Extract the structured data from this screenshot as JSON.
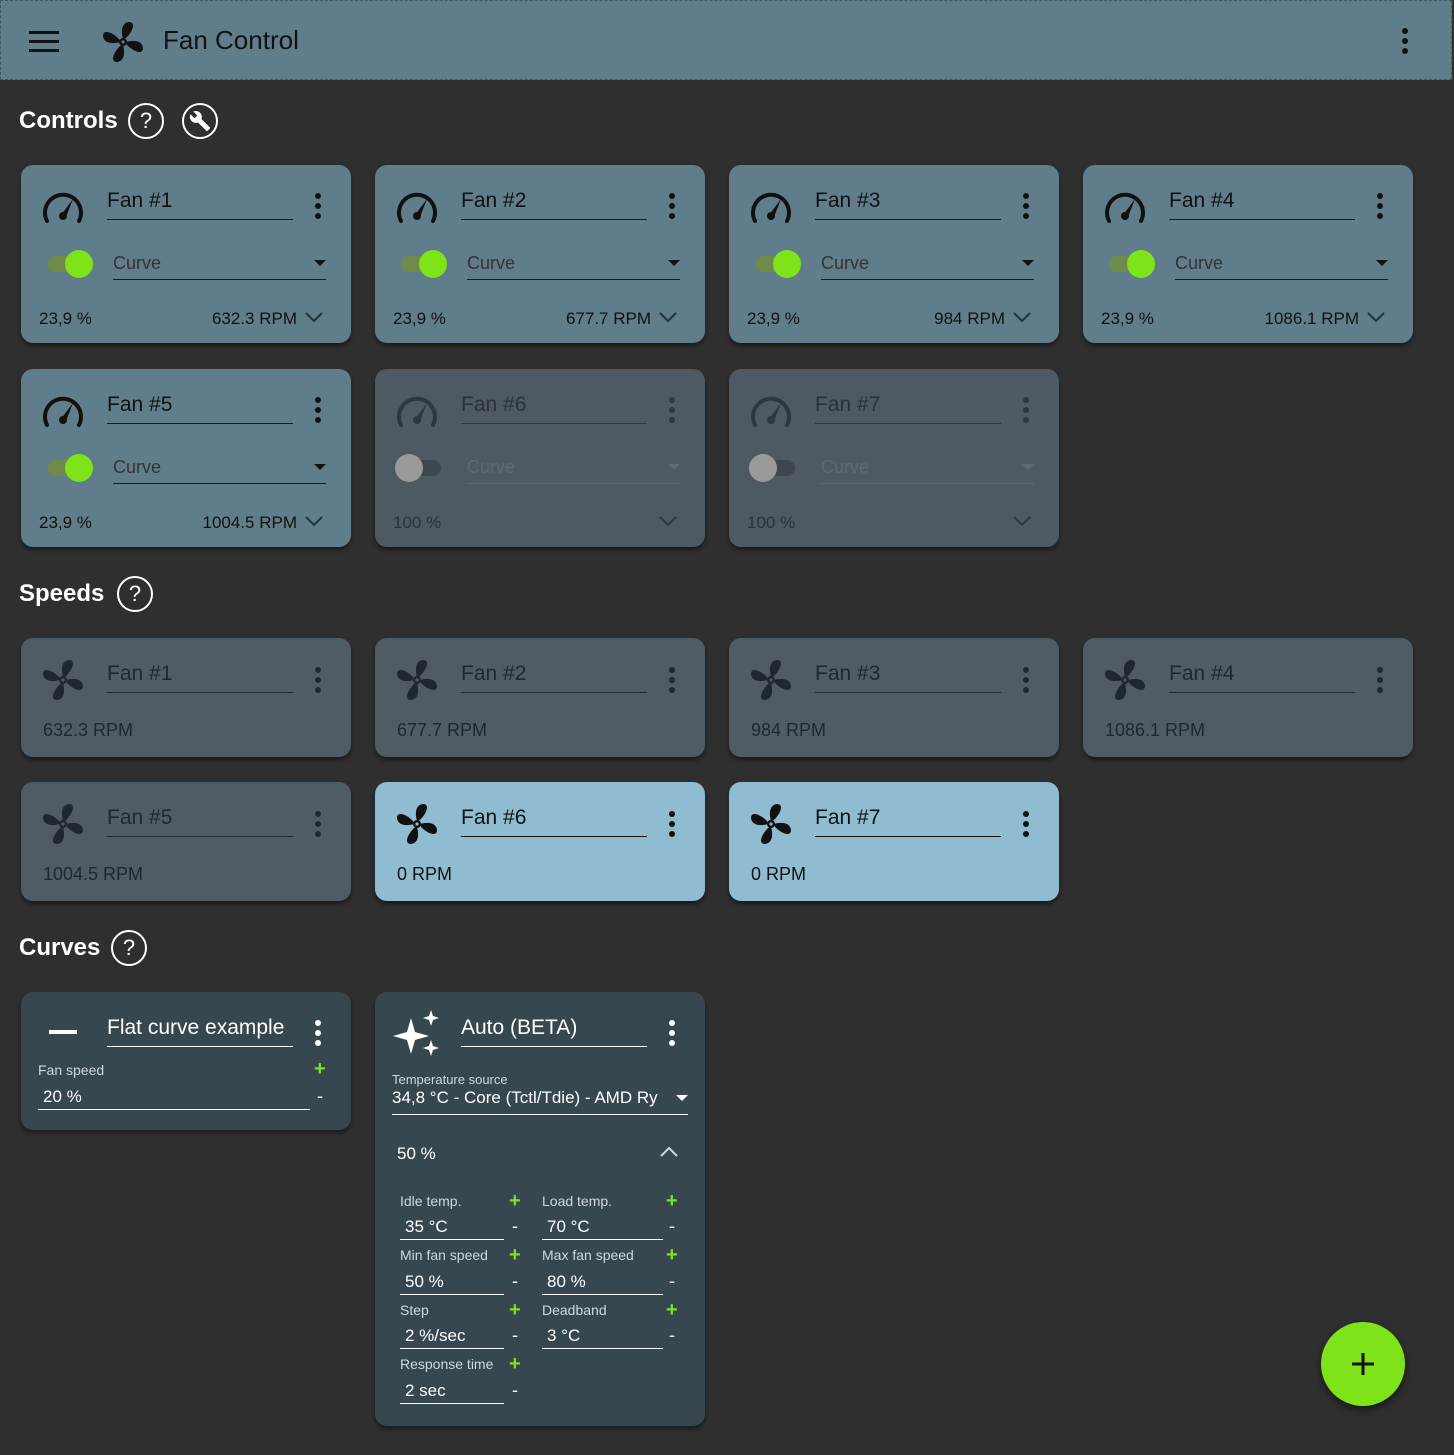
{
  "app": {
    "title": "Fan Control"
  },
  "sections": {
    "controls": "Controls",
    "speeds": "Speeds",
    "curves": "Curves",
    "help_glyph": "?"
  },
  "controls": [
    {
      "name": "Fan #1",
      "mode": "Curve",
      "percent": "23,9 %",
      "rpm": "632.3 RPM",
      "enabled": true
    },
    {
      "name": "Fan #2",
      "mode": "Curve",
      "percent": "23,9 %",
      "rpm": "677.7 RPM",
      "enabled": true
    },
    {
      "name": "Fan #3",
      "mode": "Curve",
      "percent": "23,9 %",
      "rpm": "984 RPM",
      "enabled": true
    },
    {
      "name": "Fan #4",
      "mode": "Curve",
      "percent": "23,9 %",
      "rpm": "1086.1 RPM",
      "enabled": true
    },
    {
      "name": "Fan #5",
      "mode": "Curve",
      "percent": "23,9 %",
      "rpm": "1004.5 RPM",
      "enabled": true
    },
    {
      "name": "Fan #6",
      "mode": "Curve",
      "percent": "100 %",
      "rpm": "",
      "enabled": false
    },
    {
      "name": "Fan #7",
      "mode": "Curve",
      "percent": "100 %",
      "rpm": "",
      "enabled": false
    }
  ],
  "speeds": [
    {
      "name": "Fan #1",
      "rpm": "632.3 RPM"
    },
    {
      "name": "Fan #2",
      "rpm": "677.7 RPM"
    },
    {
      "name": "Fan #3",
      "rpm": "984 RPM"
    },
    {
      "name": "Fan #4",
      "rpm": "1086.1 RPM"
    },
    {
      "name": "Fan #5",
      "rpm": "1004.5 RPM"
    },
    {
      "name": "Fan #6",
      "rpm": "0 RPM"
    },
    {
      "name": "Fan #7",
      "rpm": "0 RPM"
    }
  ],
  "flat_curve": {
    "name": "Flat curve example",
    "fan_speed_label": "Fan speed",
    "fan_speed": "20 %"
  },
  "auto_curve": {
    "name": "Auto (BETA)",
    "temp_source_label": "Temperature source",
    "temp_source": "34,8 °C - Core (Tctl/Tdie) - AMD Ry",
    "output": "50 %",
    "idle_temp_label": "Idle temp.",
    "idle_temp": "35 °C",
    "load_temp_label": "Load temp.",
    "load_temp": "70 °C",
    "min_speed_label": "Min fan speed",
    "min_speed": "50 %",
    "max_speed_label": "Max fan speed",
    "max_speed": "80 %",
    "step_label": "Step",
    "step": "2 %/sec",
    "deadband_label": "Deadband",
    "deadband": "3 °C",
    "response_label": "Response time",
    "response": "2 sec"
  },
  "stepper": {
    "plus": "+",
    "minus": "-"
  },
  "colors": {
    "accent": "#7fe31a",
    "appbar": "#607d8b",
    "background": "#2f2f2f"
  }
}
